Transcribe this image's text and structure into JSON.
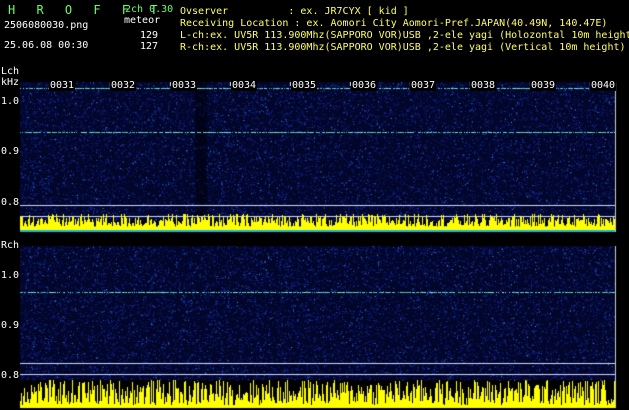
{
  "header": {
    "logo": "H R O F F T",
    "mode": "2ch 0.30",
    "filename": "2506080030.png",
    "datetime": "25.06.08 00:30",
    "meteor_label": "meteor",
    "lch_count": "129",
    "rch_count": "127",
    "observer": "Ovserver          : ex. JR7CYX [ kid ]",
    "location": "Receiving Location : ex. Aomori City Aomori-Pref.JAPAN(40.49N, 140.47E)",
    "lch_info": "L-ch:ex. UV5R 113.900Mhz(SAPPORO VOR)USB ,2-ele yagi (Holozontal 10m height",
    "rch_info": "R-ch:ex. UV5R 113.900Mhz(SAPPORO VOR)USB ,2-ele yagi (Vertical 10m height)"
  },
  "time_ticks": [
    "0031",
    "0032",
    "0033",
    "0034",
    "0035",
    "0036",
    "0037",
    "0038",
    "0039",
    "0040"
  ],
  "lch_panel": {
    "label": "Lch",
    "unit": "kHz",
    "y_ticks": [
      "1.0",
      "0.9",
      "0.8"
    ]
  },
  "rch_panel": {
    "label": "Rch",
    "y_ticks": [
      "1.0",
      "0.9",
      "0.8"
    ]
  },
  "colors": {
    "background": "#000000",
    "spectrum_noise": "#1a3acc",
    "signal": "#66ddbb",
    "bars": "#ffff00",
    "cyan_band": "#33ccff"
  }
}
